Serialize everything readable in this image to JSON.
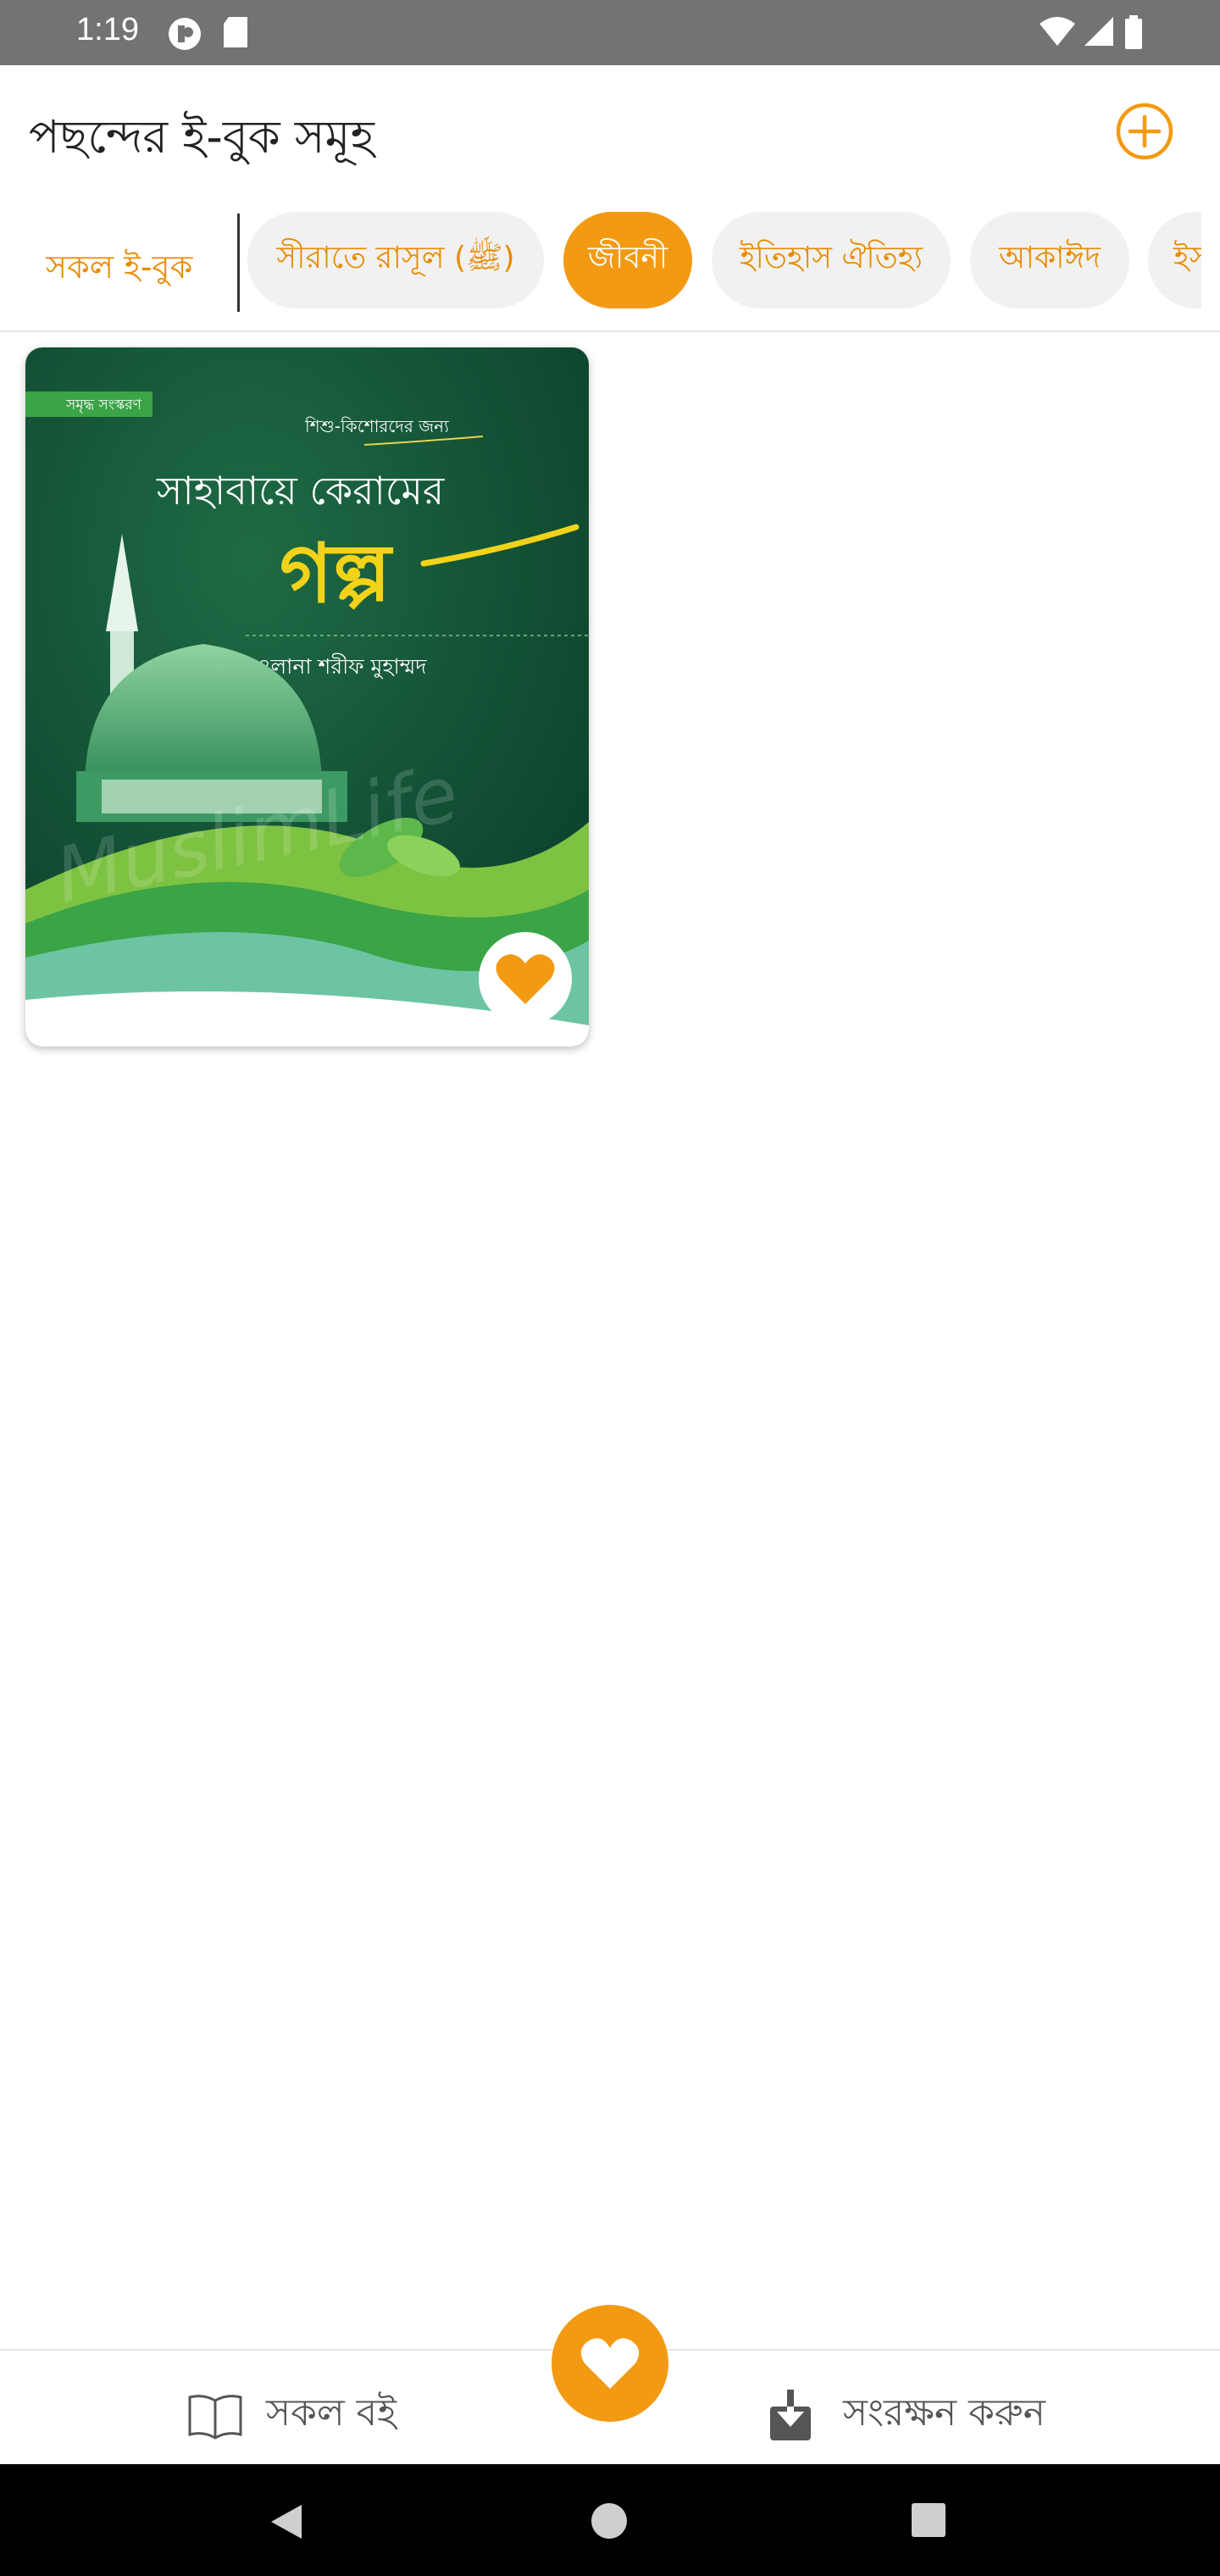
{
  "status_bar": {
    "time": "1:19"
  },
  "app_bar": {
    "title": "পছন্দের ই-বুক সমূহ"
  },
  "categories": {
    "all_label": "সকল ই-বুক",
    "chips": [
      {
        "label": "সীরাতে রাসূল (ﷺ)",
        "active": false
      },
      {
        "label": "জীবনী",
        "active": true
      },
      {
        "label": "ইতিহাস ঐতিহ্য",
        "active": false
      },
      {
        "label": "আকাঈদ",
        "active": false
      },
      {
        "label": "ইস",
        "active": false
      }
    ]
  },
  "books": [
    {
      "cover": {
        "badge": "সমৃদ্ধ সংস্করণ",
        "subtitle": "শিশু-কিশোরদের জন্য",
        "title_line1": "সাহাবায়ে কেরামের",
        "title_line2": "গল্প",
        "author": "মাওলানা শরীফ মুহাম্মদ",
        "watermark": "MuslimLife"
      },
      "favorite": true
    }
  ],
  "bottom_nav": {
    "all_books_label": "সকল বই",
    "save_label": "সংরক্ষন করুন"
  },
  "colors": {
    "accent": "#f39a12",
    "cover_green": "#0d5a3a"
  }
}
